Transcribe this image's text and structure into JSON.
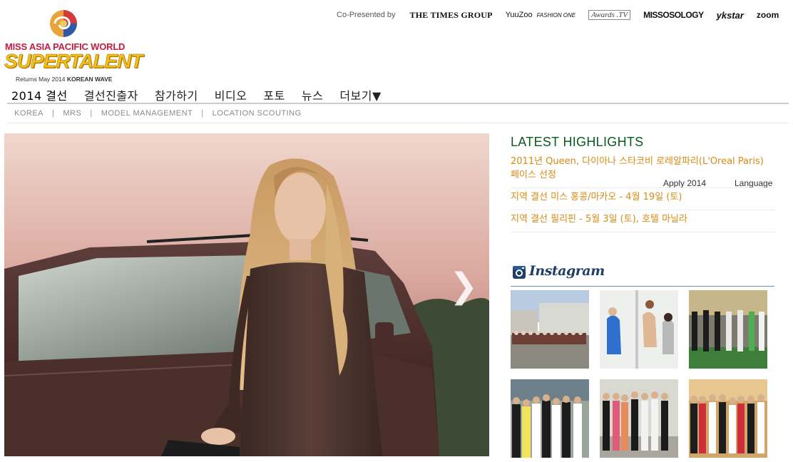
{
  "logo": {
    "line1": "MISS ASIA PACIFIC WORLD",
    "line2": "SUPERTALENT",
    "line3_prefix": "Returns May 2014",
    "line3_bold": "KOREAN WAVE"
  },
  "sponsors": {
    "label": "Co-Presented by",
    "items": [
      "THE TIMES GROUP",
      "YuuZoo",
      "FASHION ONE",
      "Awards .TV",
      "MISSOSOLOGY",
      "ykstar",
      "zoom"
    ]
  },
  "nav": {
    "items": [
      "2014 결선",
      "결선진출자",
      "참가하기",
      "비디오",
      "포토",
      "뉴스",
      "더보기▼"
    ],
    "apply": "Apply 2014",
    "language": "Language"
  },
  "subnav": {
    "items": [
      "KOREA",
      "MRS",
      "MODEL MANAGEMENT",
      "LOCATION SCOUTING"
    ],
    "separator": "|"
  },
  "hero": {
    "next_arrow": "❯"
  },
  "highlights": {
    "title": "LATEST HIGHLIGHTS",
    "items": [
      "2011년 Queen, 다이아나 스타코비 로레알파리(L'Oreal Paris) 페이스 선정",
      "지역 결선  미스 홍콩/마카오 - 4월 19일 (토)",
      "지역 결선  필리핀 - 5월 3일 (토), 호텔 마닐라"
    ]
  },
  "instagram": {
    "label": "Instagram",
    "thumbs": [
      "group-photo-outdoor",
      "contestants-by-pole",
      "contestants-on-field",
      "contestants-in-sashes",
      "contestants-lineup",
      "contestants-group"
    ]
  },
  "colors": {
    "highlight_title": "#0a5a1e",
    "highlight_link": "#d88b15",
    "logo_gold": "#f3c01a",
    "logo_red": "#c31c42"
  }
}
